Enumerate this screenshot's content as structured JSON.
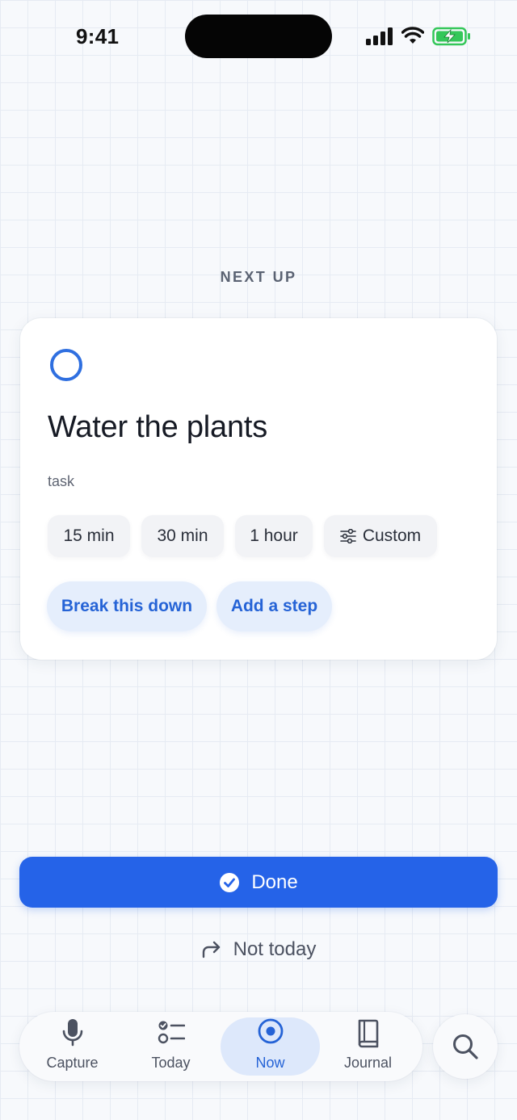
{
  "status_bar": {
    "time": "9:41",
    "icons": [
      "cellular-signal-icon",
      "wifi-icon",
      "battery-charging-icon"
    ]
  },
  "section_label": "NEXT UP",
  "task": {
    "title": "Water the plants",
    "type": "task",
    "completed": false,
    "durations": [
      "15 min",
      "30 min",
      "1 hour"
    ],
    "custom_label": "Custom",
    "actions": {
      "break_down": "Break this down",
      "add_step": "Add a step"
    }
  },
  "primary": {
    "done_label": "Done",
    "not_today_label": "Not today"
  },
  "tab_bar": {
    "active": "Now",
    "tabs": [
      {
        "label": "Capture",
        "icon": "microphone-icon"
      },
      {
        "label": "Today",
        "icon": "checklist-icon"
      },
      {
        "label": "Now",
        "icon": "target-icon"
      },
      {
        "label": "Journal",
        "icon": "book-icon"
      }
    ],
    "search_icon": "search-icon"
  },
  "colors": {
    "accent": "#2563e8",
    "accent_soft": "#e5eefc",
    "battery_green": "#34c759",
    "background": "#f7f9fc"
  }
}
